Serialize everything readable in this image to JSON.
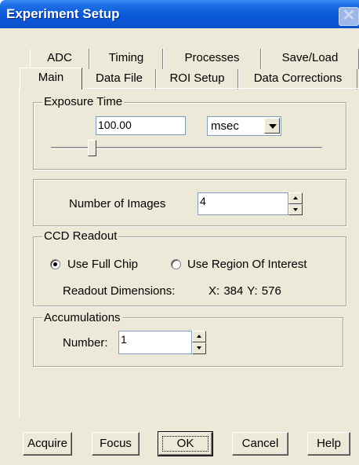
{
  "window": {
    "title": "Experiment Setup",
    "close_glyph": "✕"
  },
  "tabs": {
    "back_row": [
      {
        "label": "ADC"
      },
      {
        "label": "Timing"
      },
      {
        "label": "Processes"
      },
      {
        "label": "Save/Load"
      }
    ],
    "front_row": [
      {
        "label": "Main",
        "selected": true
      },
      {
        "label": "Data File"
      },
      {
        "label": "ROI Setup"
      },
      {
        "label": "Data Corrections"
      }
    ]
  },
  "exposure": {
    "group_label": "Exposure Time",
    "value": "100.00",
    "unit_selected": "msec",
    "slider_fraction": 0.14
  },
  "images": {
    "label": "Number of Images",
    "value": "4"
  },
  "ccd": {
    "group_label": "CCD Readout",
    "full_chip_label": "Use Full Chip",
    "full_chip_checked": true,
    "roi_label": "Use Region Of Interest",
    "roi_checked": false,
    "dims_label": "Readout Dimensions:",
    "dims_value": "X: 384  Y: 576"
  },
  "accumulations": {
    "group_label": "Accumulations",
    "number_label": "Number:",
    "value": "1"
  },
  "buttons": {
    "acquire": "Acquire",
    "focus": "Focus",
    "ok": "OK",
    "cancel": "Cancel",
    "help": "Help"
  },
  "colors": {
    "titlebar": "#0a58d8",
    "dialog_bg": "#ece9d8"
  },
  "icons": {
    "close": "close-icon",
    "dropdown": "chevron-down-icon",
    "spin_up": "arrow-up-icon",
    "spin_down": "arrow-down-icon"
  }
}
